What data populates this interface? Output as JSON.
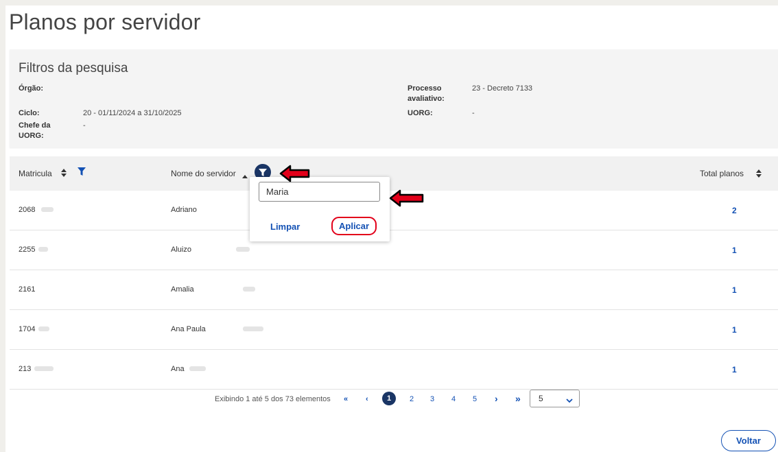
{
  "page": {
    "title": "Planos por servidor"
  },
  "filters": {
    "title": "Filtros da pesquisa",
    "orgao_label": "Órgão:",
    "orgao_value": "",
    "processo_label_1": "Processo",
    "processo_label_2": "avaliativo:",
    "processo_value": "23 - Decreto 7133",
    "ciclo_label": "Ciclo:",
    "ciclo_value": "20 - 01/11/2024 a 31/10/2025",
    "uorg_label": "UORG:",
    "uorg_value": "-",
    "chefe_label_1": "Chefe da",
    "chefe_label_2": "UORG:",
    "chefe_value": "-"
  },
  "table": {
    "columns": {
      "matricula": "Matricula",
      "nome": "Nome do servidor",
      "total": "Total planos"
    },
    "rows": [
      {
        "matricula": "2068",
        "nome": "Adriano",
        "total": "2"
      },
      {
        "matricula": "2255",
        "nome": "Aluizo",
        "total": "1"
      },
      {
        "matricula": "2161",
        "nome": "Amalia",
        "total": "1"
      },
      {
        "matricula": "1704",
        "nome": "Ana Paula",
        "total": "1"
      },
      {
        "matricula": "213",
        "nome": "Ana",
        "total": "1"
      }
    ]
  },
  "name_filter_popup": {
    "input_value": "Maria",
    "clear_label": "Limpar",
    "apply_label": "Aplicar"
  },
  "pagination": {
    "summary": "Exibindo 1 até 5 dos 73 elementos",
    "first": "«",
    "prev": "‹",
    "pages": [
      "1",
      "2",
      "3",
      "4",
      "5"
    ],
    "current": "1",
    "next": "›",
    "last": "»",
    "page_size": "5"
  },
  "actions": {
    "back_label": "Voltar"
  },
  "colors": {
    "primary": "#1351b4",
    "dark_blue": "#1a3565",
    "annotation_red": "#e2001a"
  }
}
